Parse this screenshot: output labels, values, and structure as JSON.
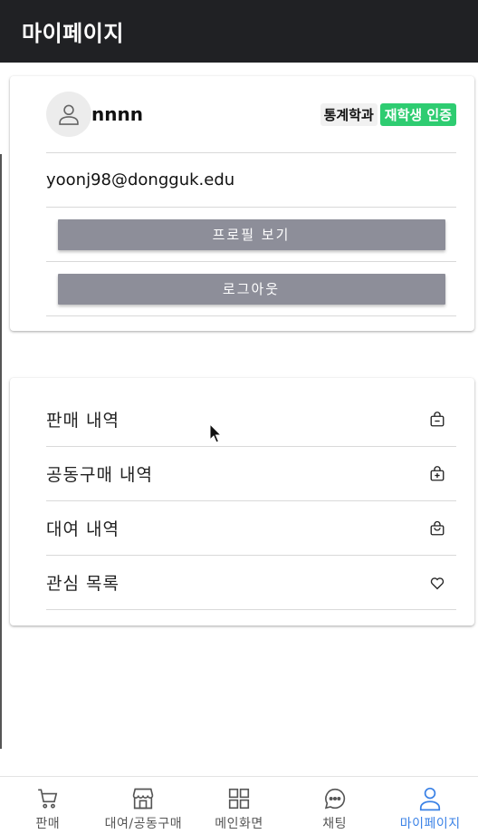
{
  "header": {
    "title": "마이페이지"
  },
  "profile": {
    "username": "nnnn",
    "department": "통계학과",
    "verified_badge": "재학생 인증",
    "email": "yoonj98@dongguk.edu",
    "view_profile_label": "프로필 보기",
    "logout_label": "로그아웃"
  },
  "menu": {
    "items": [
      {
        "label": "판매 내역",
        "icon": "shopping-bag-minus-icon"
      },
      {
        "label": "공동구매 내역",
        "icon": "shopping-bag-plus-icon"
      },
      {
        "label": "대여 내역",
        "icon": "handbag-icon"
      },
      {
        "label": "관심 목록",
        "icon": "heart-icon"
      }
    ]
  },
  "bottom_nav": {
    "items": [
      {
        "label": "판매",
        "icon": "cart-icon"
      },
      {
        "label": "대여/공동구매",
        "icon": "store-icon"
      },
      {
        "label": "메인화면",
        "icon": "grid-icon"
      },
      {
        "label": "채팅",
        "icon": "chat-icon"
      },
      {
        "label": "마이페이지",
        "icon": "person-icon",
        "active": true
      }
    ],
    "active_color": "#3b82e6"
  },
  "colors": {
    "appbar": "#202124",
    "button": "#8d8e99",
    "verified": "#2ecc71"
  }
}
